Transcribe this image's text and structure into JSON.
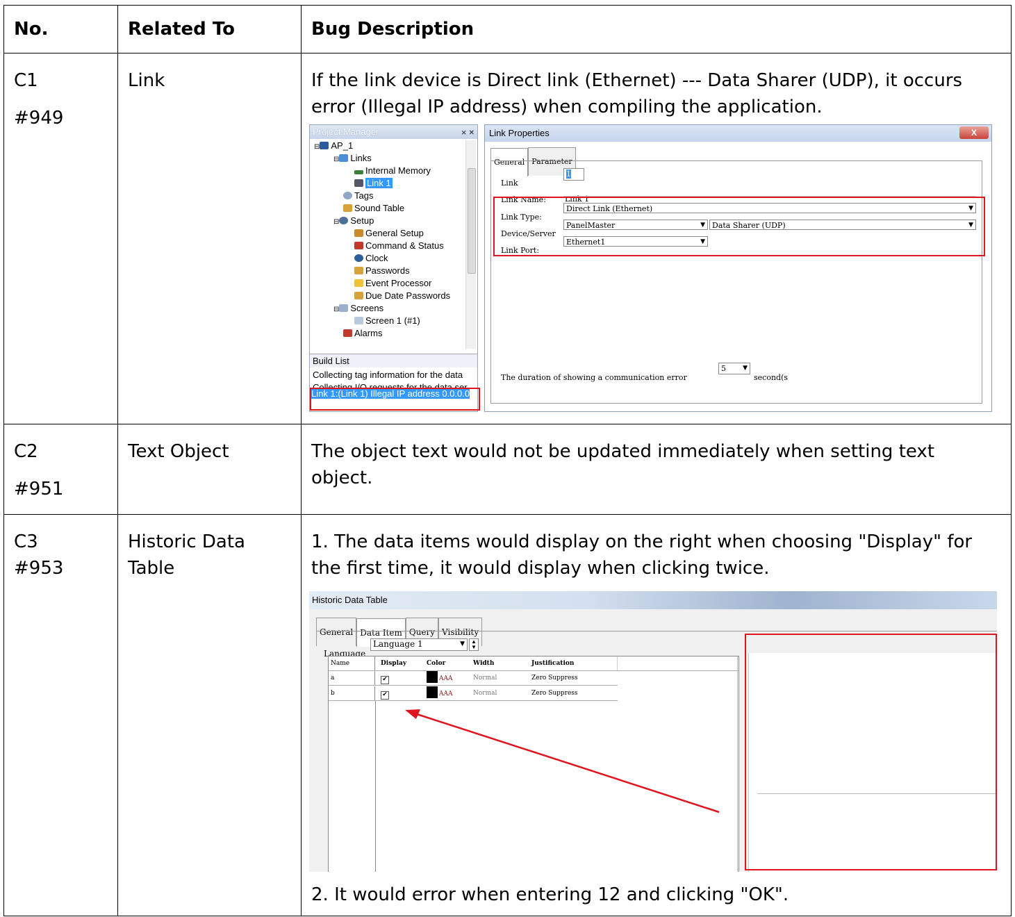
{
  "table": {
    "headers": {
      "no": "No.",
      "related": "Related To",
      "desc": "Bug Description"
    },
    "rows": [
      {
        "no": "C1",
        "id": "#949",
        "related": "Link",
        "desc": "If the link device is Direct link (Ethernet) --- Data Sharer (UDP), it occurs error (Illegal IP address) when compiling the application."
      },
      {
        "no": "C2",
        "id": "#951",
        "related": "Text Object",
        "desc": "The object text would not be updated immediately when setting text object."
      },
      {
        "no": "C3",
        "id": "#953",
        "related": "Historic Data Table",
        "desc1": "1. The data items would display on the right when choosing \"Display\" for the first time, it would display when clicking twice.",
        "desc2": "2. It would error when entering 12 and clicking \"OK\"."
      }
    ]
  },
  "shot1": {
    "project_manager": {
      "title": "Project Manager",
      "tree": [
        "AP_1",
        "Links",
        "Internal Memory",
        "Link 1",
        "Tags",
        "Sound Table",
        "Setup",
        "General Setup",
        "Command & Status",
        "Clock",
        "Passwords",
        "Event Processor",
        "Due Date Passwords",
        "Screens",
        "Screen 1 (#1)",
        "Alarms"
      ],
      "build_list_title": "Build List",
      "build_list": [
        "Collecting tag information for the data",
        "Collecting I/O requests for the data ser",
        "Link 1:(Link 1) Illegal IP address 0.0.0.0"
      ]
    },
    "link_properties": {
      "title": "Link Properties",
      "close": "X",
      "tabs": [
        "General",
        "Parameter"
      ],
      "link_label": "Link",
      "link_value": "1",
      "link_name_label": "Link Name:",
      "link_name_value": "Link 1",
      "link_type_label": "Link Type:",
      "link_type_value": "Direct Link (Ethernet)",
      "device_label": "Device/Server",
      "device_value": "PanelMaster",
      "server_value": "Data Sharer (UDP)",
      "port_label": "Link Port:",
      "port_value": "Ethernet1",
      "duration_label": "The duration of showing a communication error",
      "duration_value": "5",
      "duration_unit": "second(s"
    }
  },
  "shot2": {
    "title": "Historic Data Table",
    "tabs": [
      "General",
      "Data Item",
      "Query",
      "Visibility"
    ],
    "language_label": "Language",
    "language_value": "Language 1",
    "columns": [
      "Name",
      "Display",
      "Color",
      "Width",
      "Justification"
    ],
    "rows": [
      {
        "name": "a",
        "display": "✔",
        "color": "AAA",
        "width": "Normal",
        "justification": "Zero Suppress"
      },
      {
        "name": "b",
        "display": "✔",
        "color": "AAA",
        "width": "Normal",
        "justification": "Zero Suppress"
      }
    ]
  },
  "colors": {
    "highlight": "#e0141e",
    "selection": "#3399ff"
  },
  "icons": [
    "project-tree-icons",
    "dropdown-arrow-icon",
    "red-arrow-annotation"
  ]
}
